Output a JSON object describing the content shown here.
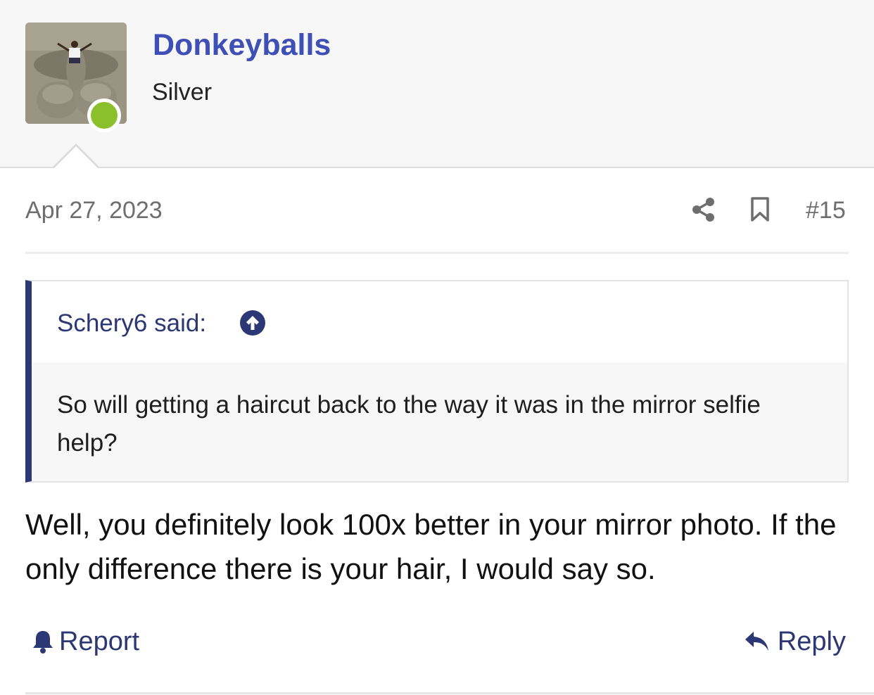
{
  "user": {
    "name": "Donkeyballs",
    "title": "Silver",
    "online_color": "#8bbf2b",
    "avatar_icon": "sand-sculpture-photo"
  },
  "post": {
    "date": "Apr 27, 2023",
    "number": "#15",
    "share_icon": "share-icon",
    "bookmark_icon": "bookmark-icon"
  },
  "quote": {
    "author": "Schery6 said:",
    "up_icon": "arrow-up-circle-icon",
    "text": "So will getting a haircut back to the way it was in the mirror selfie help?"
  },
  "message": {
    "text": "Well, you definitely look 100x better in your mirror photo. If the only difference there is your hair, I would say so."
  },
  "actions": {
    "report_label": "Report",
    "reply_label": "Reply"
  },
  "colors": {
    "username": "#3e4fb5",
    "link": "#2c3775",
    "quote_bar": "#2c3775"
  }
}
